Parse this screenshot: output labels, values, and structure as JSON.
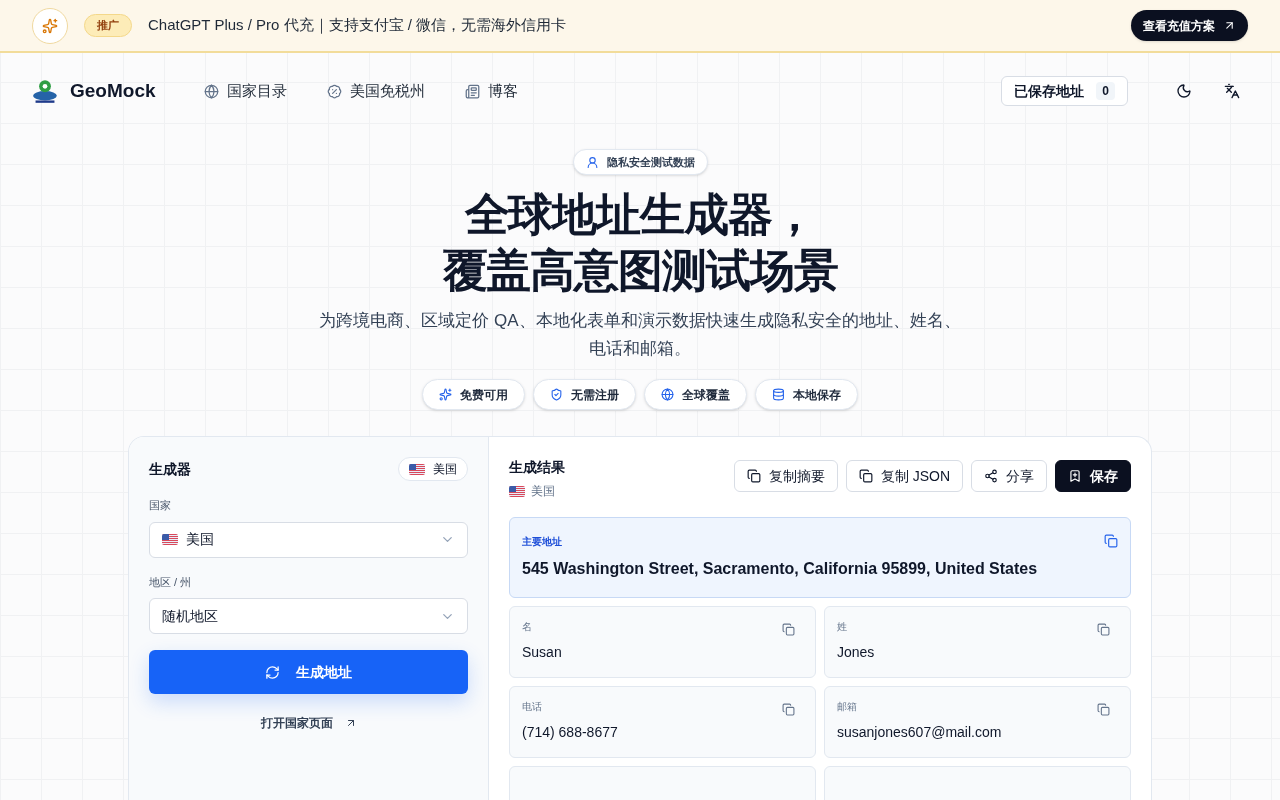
{
  "promo": {
    "badge": "推广",
    "text": "ChatGPT Plus / Pro 代充｜支持支付宝 / 微信，无需海外信用卡",
    "button": "查看充值方案"
  },
  "nav": {
    "brand": "GeoMock",
    "links": [
      "国家目录",
      "美国免税州",
      "博客"
    ],
    "saved": {
      "label": "已保存地址",
      "count": "0"
    }
  },
  "hero": {
    "pill": "隐私安全测试数据",
    "title_lines": [
      "全球地址生成器，",
      "覆盖高意图测试场景"
    ],
    "subtitle": "为跨境电商、区域定价 QA、本地化表单和演示数据快速生成隐私安全的地址、姓名、电话和邮箱。",
    "features": [
      "免费可用",
      "无需注册",
      "全球覆盖",
      "本地保存"
    ]
  },
  "generator": {
    "title": "生成器",
    "country_badge": "美国",
    "fields": [
      {
        "label": "国家",
        "value": "美国",
        "flag": true
      },
      {
        "label": "地区 / 州",
        "value": "随机地区",
        "flag": false
      }
    ],
    "button": "生成地址",
    "link": "打开国家页面"
  },
  "results": {
    "title": "生成结果",
    "country": "美国",
    "actions": [
      {
        "label": "复制摘要",
        "kind": "secondary"
      },
      {
        "label": "复制 JSON",
        "kind": "secondary"
      },
      {
        "label": "分享",
        "kind": "secondary"
      },
      {
        "label": "保存",
        "kind": "primary"
      }
    ],
    "primary": {
      "label": "主要地址",
      "value": "545 Washington Street, Sacramento, California 95899, United States"
    },
    "cards": [
      {
        "label": "名",
        "value": "Susan"
      },
      {
        "label": "姓",
        "value": "Jones"
      },
      {
        "label": "电话",
        "value": "(714) 688-8677"
      },
      {
        "label": "邮箱",
        "value": "susanjones607@mail.com"
      }
    ]
  }
}
